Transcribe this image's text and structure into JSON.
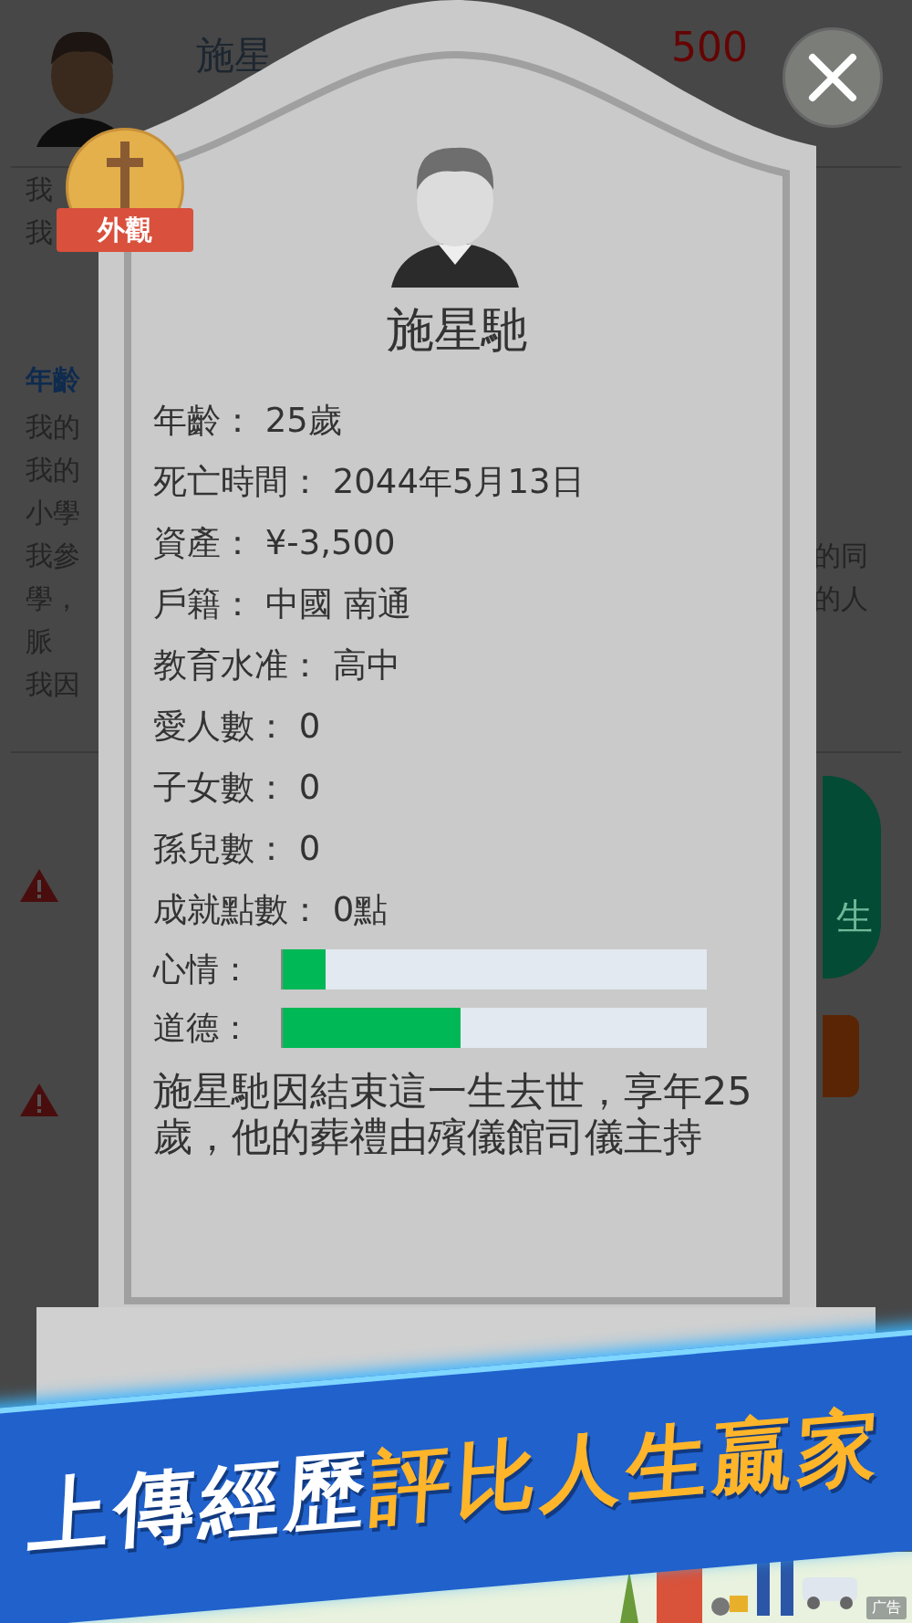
{
  "background_screen": {
    "name": "施星",
    "money": "500",
    "top_lines": [
      "我",
      "我"
    ],
    "section_title": "年齡",
    "entries": [
      {
        "left": [
          "我的"
        ]
      },
      {
        "left": [
          "我的"
        ]
      },
      {
        "left": [
          "小學"
        ]
      },
      {
        "left": [
          "我參",
          "學，",
          "脈"
        ],
        "right": [
          "的同",
          "的人"
        ]
      },
      {
        "left": [
          "我因"
        ]
      }
    ],
    "green_button": "生"
  },
  "badge": {
    "label": "外觀"
  },
  "tombstone": {
    "name": "施星馳",
    "fields": [
      {
        "label": "年齡：",
        "value": "25歲"
      },
      {
        "label": "死亡時間：",
        "value": "2044年5月13日"
      },
      {
        "label": "資產：",
        "value": "¥-3,500"
      },
      {
        "label": "戶籍：",
        "value": "中國 南通"
      },
      {
        "label": "教育水准：",
        "value": "高中"
      },
      {
        "label": "愛人數：",
        "value": "0"
      },
      {
        "label": "子女數：",
        "value": "0"
      },
      {
        "label": "孫兒數：",
        "value": "0"
      },
      {
        "label": "成就點數：",
        "value": "0點"
      }
    ],
    "meters": [
      {
        "label": "心情：",
        "level": 0.1
      },
      {
        "label": "道德：",
        "level": 0.42
      }
    ],
    "epitaph": "施星馳因結束這一生去世，享年25歲，他的葬禮由殯儀館司儀主持"
  },
  "banner": {
    "white_text": "上傳經歷",
    "orange_text": "評比人生贏家"
  },
  "ad": {
    "label": "广告"
  }
}
